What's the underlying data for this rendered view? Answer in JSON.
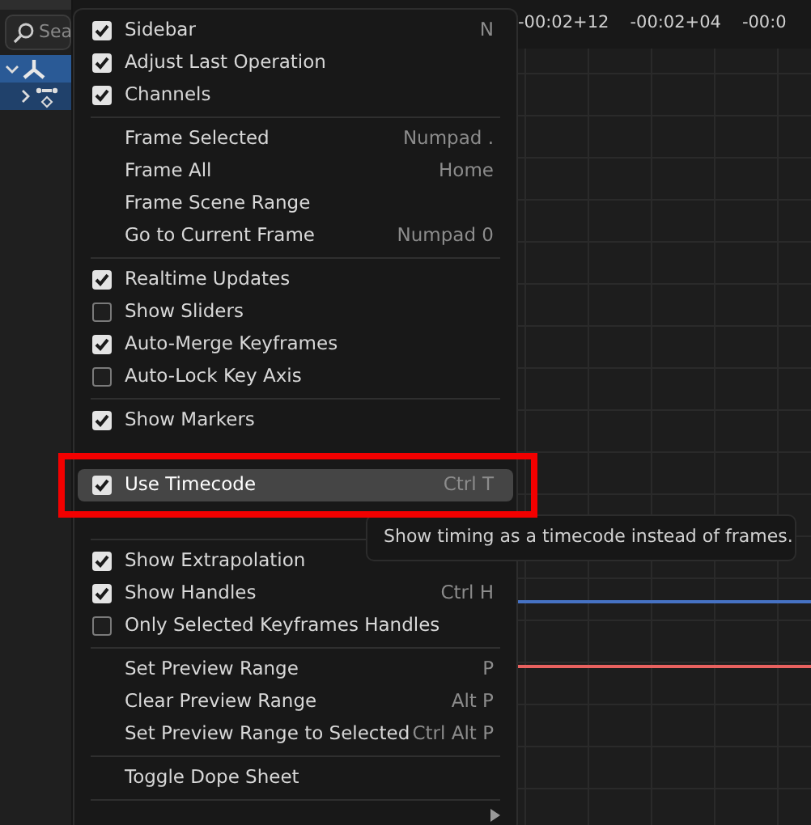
{
  "channels_panel": {
    "search": {
      "placeholder": "Sea"
    },
    "channels": [
      {
        "expanded": true,
        "selected": true
      },
      {
        "expanded": false,
        "selected": true
      }
    ]
  },
  "timeline": {
    "ticks": [
      "-00:02+12",
      "-00:02+04",
      "-00:0"
    ],
    "curves": [
      {
        "color": "#4672c4"
      },
      {
        "color": "#e8615f"
      }
    ]
  },
  "menu": {
    "items": [
      {
        "kind": "check",
        "label": "Sidebar",
        "shortcut": "N",
        "checked": true,
        "selected": false
      },
      {
        "kind": "check",
        "label": "Adjust Last Operation",
        "checked": true,
        "selected": false
      },
      {
        "kind": "check",
        "label": "Channels",
        "checked": true,
        "selected": false
      },
      {
        "kind": "separator"
      },
      {
        "kind": "plain",
        "label": "Frame Selected",
        "shortcut": "Numpad .",
        "selected": false
      },
      {
        "kind": "plain",
        "label": "Frame All",
        "shortcut": "Home",
        "selected": false
      },
      {
        "kind": "plain",
        "label": "Frame Scene Range",
        "selected": false
      },
      {
        "kind": "plain",
        "label": "Go to Current Frame",
        "shortcut": "Numpad 0",
        "selected": false
      },
      {
        "kind": "separator"
      },
      {
        "kind": "check",
        "label": "Realtime Updates",
        "checked": true,
        "selected": false
      },
      {
        "kind": "check",
        "label": "Show Sliders",
        "checked": false,
        "selected": false
      },
      {
        "kind": "check",
        "label": "Auto-Merge Keyframes",
        "checked": true,
        "selected": false
      },
      {
        "kind": "check",
        "label": "Auto-Lock Key Axis",
        "checked": false,
        "selected": false
      },
      {
        "kind": "separator"
      },
      {
        "kind": "check",
        "label": "Show Markers",
        "checked": true,
        "selected": false
      },
      {
        "kind": "covered"
      },
      {
        "kind": "check",
        "label": "Use Timecode",
        "shortcut": "Ctrl T",
        "checked": true,
        "selected": true
      },
      {
        "kind": "covered"
      },
      {
        "kind": "separator"
      },
      {
        "kind": "check",
        "label": "Show Extrapolation",
        "checked": true,
        "selected": false
      },
      {
        "kind": "check",
        "label": "Show Handles",
        "shortcut": "Ctrl H",
        "checked": true,
        "selected": false
      },
      {
        "kind": "check",
        "label": "Only Selected Keyframes Handles",
        "checked": false,
        "selected": false
      },
      {
        "kind": "separator"
      },
      {
        "kind": "plain",
        "label": "Set Preview Range",
        "shortcut": "P",
        "selected": false
      },
      {
        "kind": "plain",
        "label": "Clear Preview Range",
        "shortcut": "Alt P",
        "selected": false
      },
      {
        "kind": "plain",
        "label": "Set Preview Range to Selected",
        "shortcut": "Ctrl Alt P",
        "selected": false
      },
      {
        "kind": "separator"
      },
      {
        "kind": "plain",
        "label": "Toggle Dope Sheet",
        "selected": false
      },
      {
        "kind": "separator"
      },
      {
        "kind": "submenu",
        "selected": false
      }
    ]
  },
  "tooltip": {
    "text": "Show timing as a timecode instead of frames."
  }
}
